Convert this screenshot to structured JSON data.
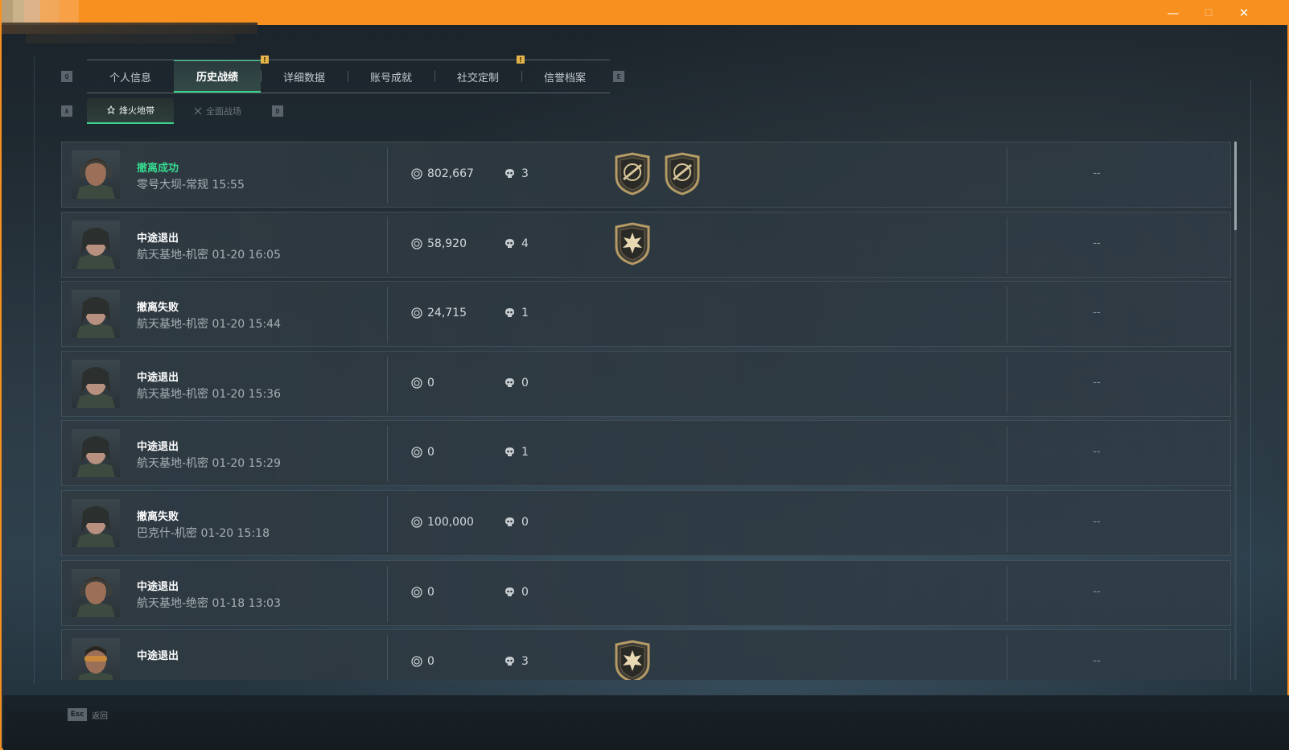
{
  "window": {
    "minimize_glyph": "—",
    "maximize_glyph": "☐",
    "close_glyph": "✕"
  },
  "tab_hints": {
    "left": "Q",
    "right": "E"
  },
  "tabs": [
    {
      "label": "个人信息",
      "active": false
    },
    {
      "label": "历史战绩",
      "active": true
    },
    {
      "label": "详细数据",
      "active": false,
      "notify": "!"
    },
    {
      "label": "账号成就",
      "active": false
    },
    {
      "label": "社交定制",
      "active": false
    },
    {
      "label": "信誉档案",
      "active": false,
      "notify": "!"
    }
  ],
  "subtab_hints": {
    "left": "A",
    "right": "D"
  },
  "subtabs": [
    {
      "label": "烽火地带",
      "active": true
    },
    {
      "label": "全面战场",
      "active": false
    }
  ],
  "rows": [
    {
      "status": "撤离成功",
      "success": true,
      "subline": "零号大坝-常规 15:55",
      "money": "802,667",
      "kills": "3",
      "badges": [
        "sniper-badge-icon",
        "sniper-badge-icon"
      ],
      "extra": "--",
      "avatar": "soldier-headset"
    },
    {
      "status": "中途退出",
      "success": false,
      "subline": "航天基地-机密 01-20 16:05",
      "money": "58,920",
      "kills": "4",
      "badges": [
        "burst-badge-icon"
      ],
      "extra": "--",
      "avatar": "soldier-female"
    },
    {
      "status": "撤离失败",
      "success": false,
      "subline": "航天基地-机密 01-20 15:44",
      "money": "24,715",
      "kills": "1",
      "badges": [],
      "extra": "--",
      "avatar": "soldier-female"
    },
    {
      "status": "中途退出",
      "success": false,
      "subline": "航天基地-机密 01-20 15:36",
      "money": "0",
      "kills": "0",
      "badges": [],
      "extra": "--",
      "avatar": "soldier-female"
    },
    {
      "status": "中途退出",
      "success": false,
      "subline": "航天基地-机密 01-20 15:29",
      "money": "0",
      "kills": "1",
      "badges": [],
      "extra": "--",
      "avatar": "soldier-female"
    },
    {
      "status": "撤离失败",
      "success": false,
      "subline": "巴克什-机密 01-20 15:18",
      "money": "100,000",
      "kills": "0",
      "badges": [],
      "extra": "--",
      "avatar": "soldier-female"
    },
    {
      "status": "中途退出",
      "success": false,
      "subline": "航天基地-绝密 01-18 13:03",
      "money": "0",
      "kills": "0",
      "badges": [],
      "extra": "--",
      "avatar": "soldier-headset"
    },
    {
      "status": "中途退出",
      "success": false,
      "subline": "",
      "money": "0",
      "kills": "3",
      "badges": [
        "burst-badge-icon"
      ],
      "extra": "--",
      "avatar": "soldier-goggles"
    }
  ],
  "footer": {
    "esc_key": "Esc",
    "esc_label": "返回"
  },
  "colors": {
    "titlebar": "#f7901e",
    "accent": "#3bd28c",
    "success_text": "#36d98f",
    "notify": "#e3b44a"
  }
}
